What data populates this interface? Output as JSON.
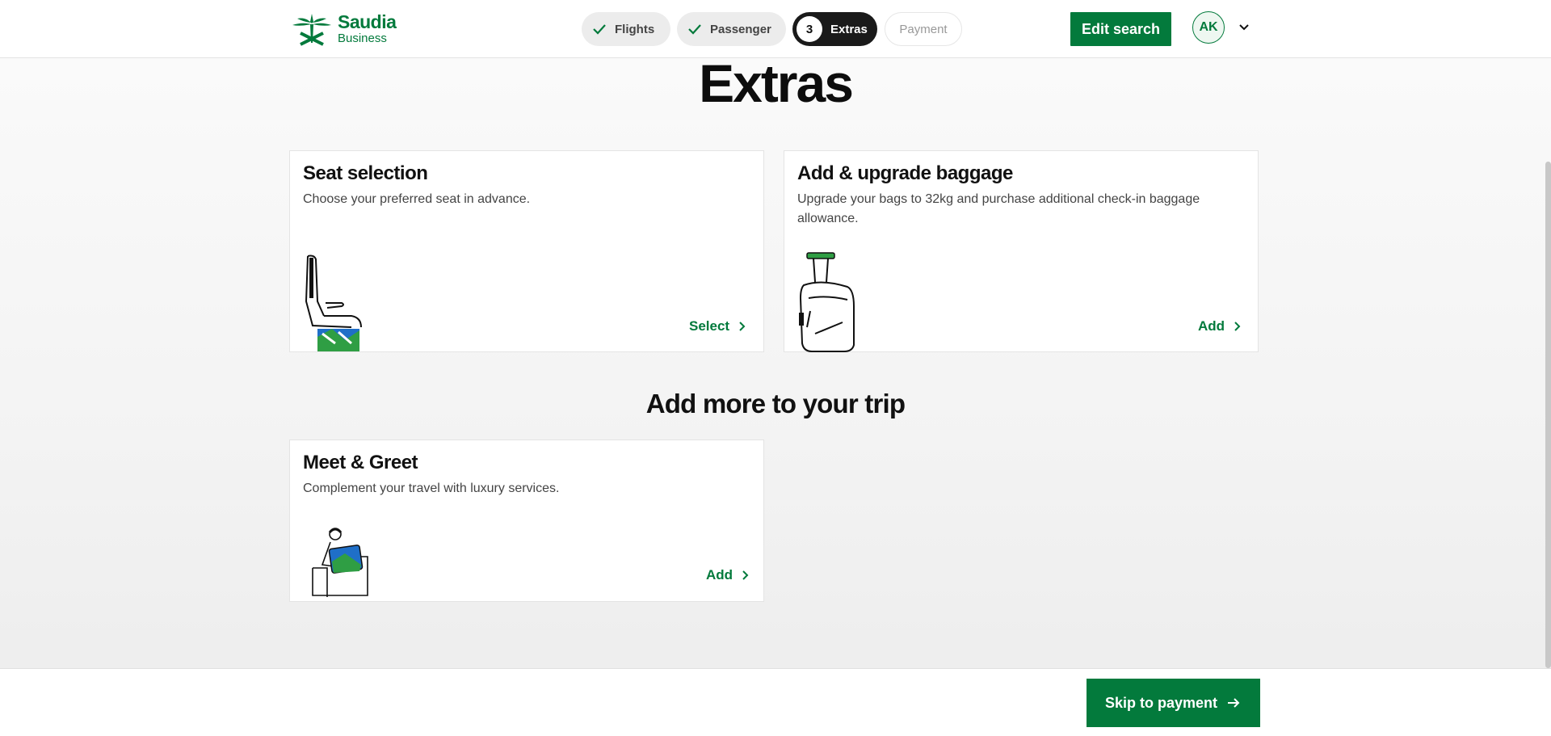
{
  "brand": {
    "name": "Saudia",
    "sub": "Business",
    "color": "#037a3c"
  },
  "stepper": [
    {
      "label": "Flights",
      "state": "done"
    },
    {
      "label": "Passenger",
      "state": "done"
    },
    {
      "label": "Extras",
      "number": "3",
      "state": "active"
    },
    {
      "label": "Payment",
      "state": "pending"
    }
  ],
  "header": {
    "edit_search": "Edit search",
    "avatar_initials": "AK"
  },
  "page": {
    "title": "Extras"
  },
  "cards": [
    {
      "title": "Seat selection",
      "description": "Choose your preferred seat in advance.",
      "action": "Select"
    },
    {
      "title": "Add & upgrade baggage",
      "description": "Upgrade your bags to 32kg and purchase additional check-in baggage allowance.",
      "action": "Add"
    }
  ],
  "more": {
    "title": "Add more to your trip",
    "cards": [
      {
        "title": "Meet & Greet",
        "description": "Complement your travel with luxury services.",
        "action": "Add"
      }
    ]
  },
  "footer": {
    "skip_label": "Skip to payment"
  }
}
